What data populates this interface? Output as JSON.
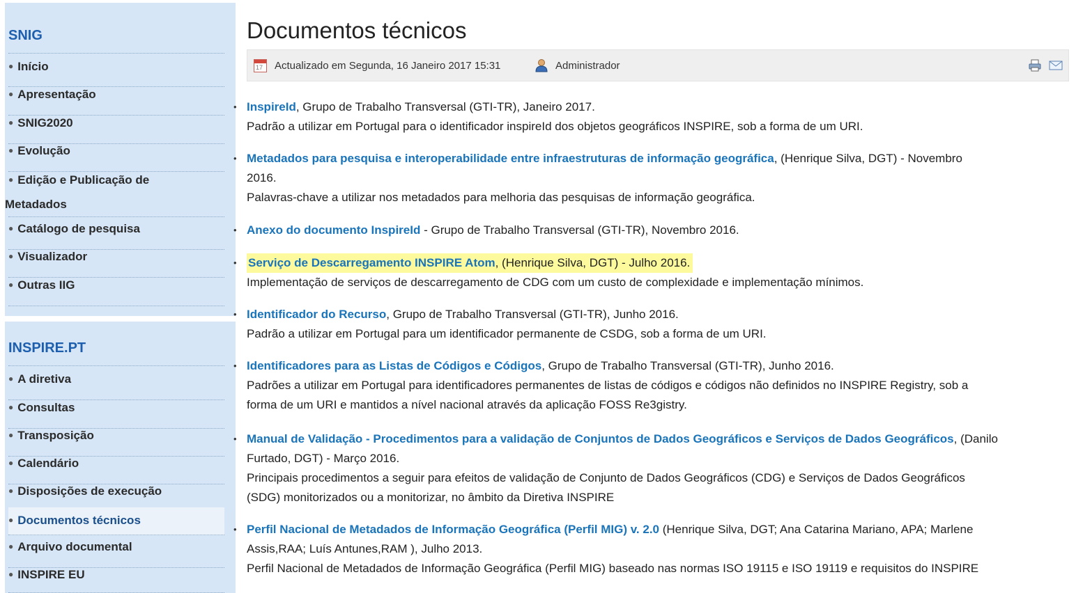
{
  "sidebar": {
    "snig": {
      "title": "SNIG",
      "items": [
        {
          "label": "Início"
        },
        {
          "label": "Apresentação"
        },
        {
          "label": "SNIG2020"
        },
        {
          "label": "Evolução"
        },
        {
          "label": "Edição e Publicação de",
          "label2": "Metadados"
        },
        {
          "label": "Catálogo de pesquisa"
        },
        {
          "label": "Visualizador"
        },
        {
          "label": "Outras IIG"
        }
      ]
    },
    "inspire": {
      "title": "INSPIRE.PT",
      "items": [
        {
          "label": "A diretiva"
        },
        {
          "label": "Consultas"
        },
        {
          "label": "Transposição"
        },
        {
          "label": "Calendário"
        },
        {
          "label": "Disposições de execução"
        },
        {
          "label": "Documentos técnicos",
          "active": true
        },
        {
          "label": "Arquivo documental"
        },
        {
          "label": "INSPIRE EU"
        }
      ]
    }
  },
  "main": {
    "title": "Documentos técnicos",
    "meta": {
      "updated": "Actualizado em Segunda, 16 Janeiro 2017 15:31",
      "author": "Administrador",
      "calendar_day": "17"
    },
    "documents": [
      {
        "link": "InspireId",
        "after_link": ", Grupo de Trabalho Transversal (GTI-TR), Janeiro 2017.",
        "lines": [
          "Padrão a utilizar em Portugal para o identificador inspireId dos objetos geográficos INSPIRE, sob a forma de um URI."
        ]
      },
      {
        "link": "Metadados para pesquisa e interoperabilidade entre infraestruturas de informação geográfica",
        "after_link": ", (Henrique Silva, DGT) - Novembro",
        "lines": [
          "2016.",
          "Palavras-chave a utilizar nos metadados para melhoria das pesquisas de informação geográfica."
        ]
      },
      {
        "link": "Anexo do documento InspireId",
        "after_link": " - Grupo de Trabalho Transversal (GTI-TR), Novembro 2016.",
        "lines": []
      },
      {
        "link": "Serviço de Descarregamento INSPIRE Atom",
        "after_link": ", (Henrique Silva, DGT) - Julho 2016.",
        "highlight": true,
        "lines": [
          "Implementação de serviços de descarregamento de CDG com um custo de complexidade e implementação mínimos."
        ]
      },
      {
        "link": "Identificador do Recurso",
        "after_link": ", Grupo de Trabalho Transversal (GTI-TR), Junho 2016.",
        "lines": [
          "Padrão a utilizar em Portugal para um identificador permanente de CSDG, sob a forma de um URI."
        ]
      },
      {
        "link": "Identificadores para as Listas de Códigos e Códigos",
        "after_link": ", Grupo de Trabalho Transversal (GTI-TR), Junho 2016.",
        "lines": [
          "Padrões a utilizar em Portugal para identificadores permanentes de listas de códigos e códigos não definidos no INSPIRE Registry, sob a",
          "forma de um URI e mantidos a nível nacional através da aplicação FOSS Re3gistry."
        ]
      },
      {
        "link": "Manual de Validação - Procedimentos para a validação de Conjuntos de Dados Geográficos e Serviços de Dados Geográficos",
        "after_link": ", (Danilo",
        "lines": [
          "Furtado, DGT) - Março 2016.",
          "Principais procedimentos a seguir para efeitos de validação de Conjunto de Dados Geográficos (CDG) e Serviços de Dados Geográficos",
          "(SDG) monitorizados ou a monitorizar, no âmbito da Diretiva INSPIRE"
        ]
      },
      {
        "link": "Perfil Nacional de Metadados de Informação Geográfica (Perfil MIG) v. 2.0",
        "after_link": " (Henrique Silva, DGT; Ana Catarina Mariano, APA; Marlene",
        "lines": [
          "Assis,RAA; Luís Antunes,RAM ), Julho 2013.",
          "Perfil Nacional de Metadados de Informação Geográfica (Perfil MIG) baseado nas normas ISO 19115 e ISO 19119 e requisitos do INSPIRE"
        ]
      }
    ]
  },
  "colors": {
    "sidebar_bg": "#d6e6f6",
    "module_title": "#1d5fae",
    "link": "#1a74ba",
    "highlight": "#fdfa9e"
  }
}
